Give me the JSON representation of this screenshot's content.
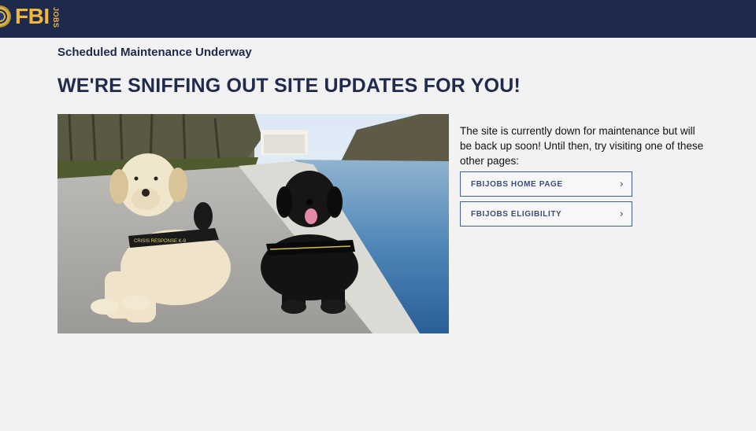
{
  "header": {
    "logo_text": "FBI",
    "logo_sub": "JOBS",
    "brand_color": "#f3b73c",
    "bar_color": "#1e2a4d"
  },
  "main": {
    "kicker": "Scheduled Maintenance Underway",
    "headline": "WE'RE SNIFFING OUT SITE UPDATES FOR YOU!",
    "photo": {
      "description_icon": "two-labrador-dogs-photo",
      "vest_text": "CRISIS RESPONSE K-9"
    },
    "message": "The site is currently down for maintenance but will be back up soon! Until then, try visiting one of these other pages:",
    "links": [
      {
        "label": "FBIJOBS HOME PAGE",
        "icon": "chevron-right-icon"
      },
      {
        "label": "FBIJOBS ELIGIBILITY",
        "icon": "chevron-right-icon"
      }
    ]
  }
}
